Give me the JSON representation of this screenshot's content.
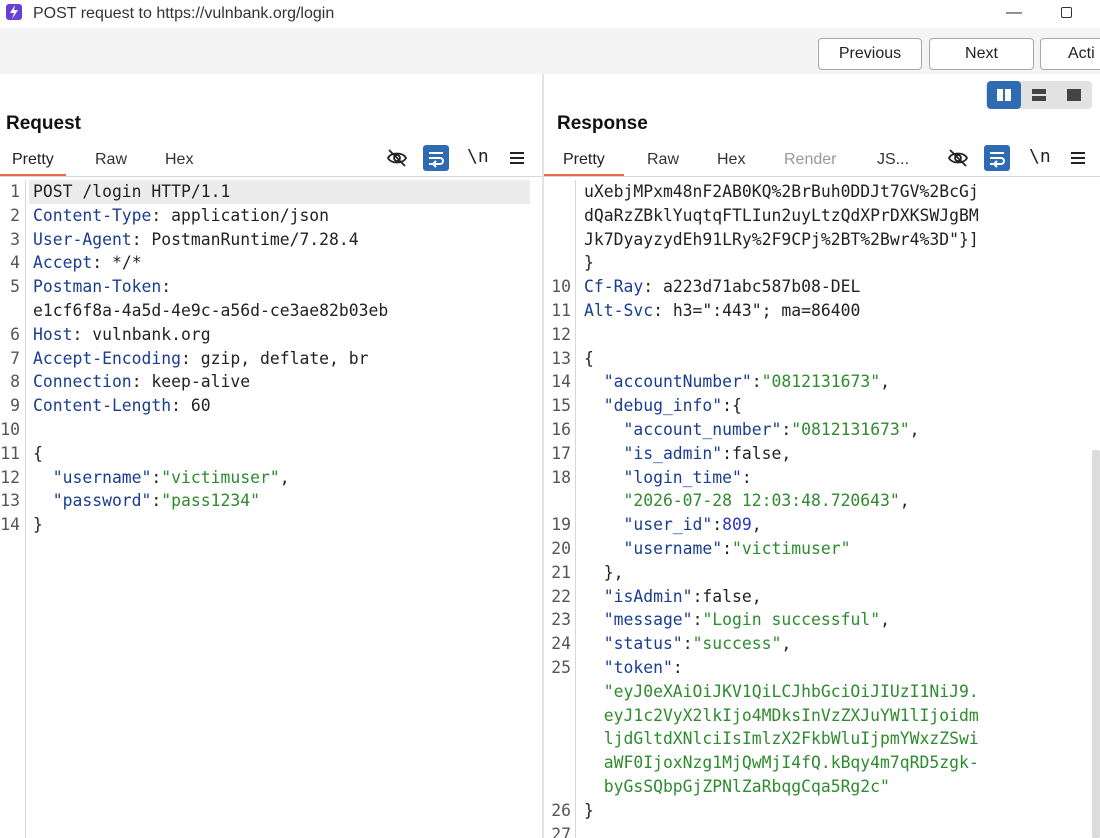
{
  "window": {
    "title": "POST request to https://vulnbank.org/login",
    "app_icon": "lightning-icon",
    "minimize_label": "—"
  },
  "toolbar": {
    "previous_label": "Previous",
    "next_label": "Next",
    "action_label": "Acti"
  },
  "layout_toggle": {
    "items": [
      "split-columns-icon",
      "split-rows-icon",
      "single-pane-icon"
    ],
    "active_color": "#2f6bb3"
  },
  "request": {
    "title": "Request",
    "tabs": [
      "Pretty",
      "Raw",
      "Hex"
    ],
    "active_tab": "Pretty",
    "newline_toggle": "\\n",
    "lines": [
      {
        "num": "1",
        "parts": [
          {
            "t": "POST /login HTTP/1.1",
            "c": "v"
          }
        ]
      },
      {
        "num": "2",
        "parts": [
          {
            "t": "Content-Type",
            "c": "k"
          },
          {
            "t": ": application/json",
            "c": "v"
          }
        ]
      },
      {
        "num": "3",
        "parts": [
          {
            "t": "User-Agent",
            "c": "k"
          },
          {
            "t": ": PostmanRuntime/7.28.4",
            "c": "v"
          }
        ]
      },
      {
        "num": "4",
        "parts": [
          {
            "t": "Accept",
            "c": "k"
          },
          {
            "t": ": */*",
            "c": "v"
          }
        ]
      },
      {
        "num": "5",
        "parts": [
          {
            "t": "Postman-Token",
            "c": "k"
          },
          {
            "t": ":",
            "c": "v"
          }
        ]
      },
      {
        "num": "",
        "parts": [
          {
            "t": "e1cf6f8a-4a5d-4e9c-a56d-ce3ae82b03eb",
            "c": "v"
          }
        ]
      },
      {
        "num": "6",
        "parts": [
          {
            "t": "Host",
            "c": "k"
          },
          {
            "t": ": vulnbank.org",
            "c": "v"
          }
        ]
      },
      {
        "num": "7",
        "parts": [
          {
            "t": "Accept-Encoding",
            "c": "k"
          },
          {
            "t": ": gzip, deflate, br",
            "c": "v"
          }
        ]
      },
      {
        "num": "8",
        "parts": [
          {
            "t": "Connection",
            "c": "k"
          },
          {
            "t": ": keep-alive",
            "c": "v"
          }
        ]
      },
      {
        "num": "9",
        "parts": [
          {
            "t": "Content-Length",
            "c": "k"
          },
          {
            "t": ": 60",
            "c": "v"
          }
        ]
      },
      {
        "num": "10",
        "parts": []
      },
      {
        "num": "11",
        "parts": [
          {
            "t": "{",
            "c": "p"
          }
        ]
      },
      {
        "num": "12",
        "parts": [
          {
            "t": "  \"username\"",
            "c": "k"
          },
          {
            "t": ":",
            "c": "p"
          },
          {
            "t": "\"victimuser\"",
            "c": "s"
          },
          {
            "t": ",",
            "c": "p"
          }
        ]
      },
      {
        "num": "13",
        "parts": [
          {
            "t": "  \"password\"",
            "c": "k"
          },
          {
            "t": ":",
            "c": "p"
          },
          {
            "t": "\"pass1234\"",
            "c": "s"
          }
        ]
      },
      {
        "num": "14",
        "parts": [
          {
            "t": "}",
            "c": "p"
          }
        ]
      }
    ]
  },
  "response": {
    "title": "Response",
    "tabs": [
      "Pretty",
      "Raw",
      "Hex",
      "Render",
      "JS..."
    ],
    "active_tab": "Pretty",
    "newline_toggle": "\\n",
    "lines": [
      {
        "num": "",
        "parts": [
          {
            "t": "uXebjMPxm48nF2AB0KQ%2BrBuh0DDJt7GV%2BcGj",
            "c": "v"
          }
        ]
      },
      {
        "num": "",
        "parts": [
          {
            "t": "dQaRzZBklYuqtqFTLIun2uyLtzQdXPrDXKSWJgBM",
            "c": "v"
          }
        ]
      },
      {
        "num": "",
        "parts": [
          {
            "t": "Jk7DyayzydEh91LRy%2F9CPj%2BT%2Bwr4%3D\"}]",
            "c": "v"
          }
        ]
      },
      {
        "num": "",
        "parts": [
          {
            "t": "}",
            "c": "v"
          }
        ]
      },
      {
        "num": "10",
        "parts": [
          {
            "t": "Cf-Ray",
            "c": "k"
          },
          {
            "t": ": a223d71abc587b08-DEL",
            "c": "v"
          }
        ]
      },
      {
        "num": "11",
        "parts": [
          {
            "t": "Alt-Svc",
            "c": "k"
          },
          {
            "t": ": h3=\":443\"; ma=86400",
            "c": "v"
          }
        ]
      },
      {
        "num": "12",
        "parts": []
      },
      {
        "num": "13",
        "parts": [
          {
            "t": "{",
            "c": "p"
          }
        ]
      },
      {
        "num": "14",
        "parts": [
          {
            "t": "  \"accountNumber\"",
            "c": "k"
          },
          {
            "t": ":",
            "c": "p"
          },
          {
            "t": "\"0812131673\"",
            "c": "s"
          },
          {
            "t": ",",
            "c": "p"
          }
        ]
      },
      {
        "num": "15",
        "parts": [
          {
            "t": "  \"debug_info\"",
            "c": "k"
          },
          {
            "t": ":{",
            "c": "p"
          }
        ]
      },
      {
        "num": "16",
        "parts": [
          {
            "t": "    \"account_number\"",
            "c": "k"
          },
          {
            "t": ":",
            "c": "p"
          },
          {
            "t": "\"0812131673\"",
            "c": "s"
          },
          {
            "t": ",",
            "c": "p"
          }
        ]
      },
      {
        "num": "17",
        "parts": [
          {
            "t": "    \"is_admin\"",
            "c": "k"
          },
          {
            "t": ":false,",
            "c": "p"
          }
        ]
      },
      {
        "num": "18",
        "parts": [
          {
            "t": "    \"login_time\"",
            "c": "k"
          },
          {
            "t": ":",
            "c": "p"
          }
        ]
      },
      {
        "num": "",
        "parts": [
          {
            "t": "    \"2026-07-28 12:03:48.720643\"",
            "c": "s"
          },
          {
            "t": ",",
            "c": "p"
          }
        ]
      },
      {
        "num": "19",
        "parts": [
          {
            "t": "    \"user_id\"",
            "c": "k"
          },
          {
            "t": ":",
            "c": "p"
          },
          {
            "t": "809",
            "c": "n"
          },
          {
            "t": ",",
            "c": "p"
          }
        ]
      },
      {
        "num": "20",
        "parts": [
          {
            "t": "    \"username\"",
            "c": "k"
          },
          {
            "t": ":",
            "c": "p"
          },
          {
            "t": "\"victimuser\"",
            "c": "s"
          }
        ]
      },
      {
        "num": "21",
        "parts": [
          {
            "t": "  },",
            "c": "p"
          }
        ]
      },
      {
        "num": "22",
        "parts": [
          {
            "t": "  \"isAdmin\"",
            "c": "k"
          },
          {
            "t": ":false,",
            "c": "p"
          }
        ]
      },
      {
        "num": "23",
        "parts": [
          {
            "t": "  \"message\"",
            "c": "k"
          },
          {
            "t": ":",
            "c": "p"
          },
          {
            "t": "\"Login successful\"",
            "c": "s"
          },
          {
            "t": ",",
            "c": "p"
          }
        ]
      },
      {
        "num": "24",
        "parts": [
          {
            "t": "  \"status\"",
            "c": "k"
          },
          {
            "t": ":",
            "c": "p"
          },
          {
            "t": "\"success\"",
            "c": "s"
          },
          {
            "t": ",",
            "c": "p"
          }
        ]
      },
      {
        "num": "25",
        "parts": [
          {
            "t": "  \"token\"",
            "c": "k"
          },
          {
            "t": ":",
            "c": "p"
          }
        ]
      },
      {
        "num": "",
        "parts": [
          {
            "t": "  \"eyJ0eXAiOiJKV1QiLCJhbGciOiJIUzI1NiJ9.",
            "c": "s"
          }
        ]
      },
      {
        "num": "",
        "parts": [
          {
            "t": "  eyJ1c2VyX2lkIjo4MDksInVzZXJuYW1lIjoidm",
            "c": "s"
          }
        ]
      },
      {
        "num": "",
        "parts": [
          {
            "t": "  ljdGltdXNlciIsImlzX2FkbWluIjpmYWxzZSwi",
            "c": "s"
          }
        ]
      },
      {
        "num": "",
        "parts": [
          {
            "t": "  aWF0IjoxNzg1MjQwMjI4fQ.kBqy4m7qRD5zgk-",
            "c": "s"
          }
        ]
      },
      {
        "num": "",
        "parts": [
          {
            "t": "  byGsSQbpGjZPNlZaRbqgCqa5Rg2c\"",
            "c": "s"
          }
        ]
      },
      {
        "num": "26",
        "parts": [
          {
            "t": "}",
            "c": "p"
          }
        ]
      },
      {
        "num": "27",
        "parts": []
      }
    ]
  }
}
